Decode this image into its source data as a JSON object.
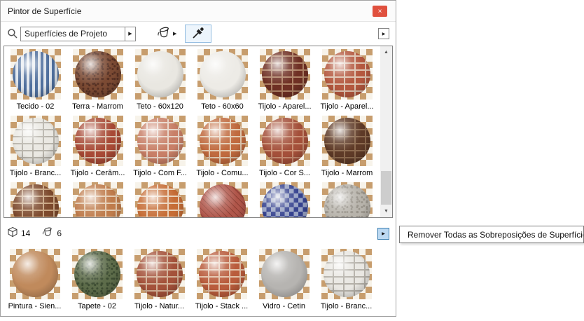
{
  "window": {
    "title": "Pintor de Superfície"
  },
  "icons": {
    "close": "×",
    "flyout": "▶",
    "scroll_up": "▲",
    "scroll_down": "▼"
  },
  "toolbar": {
    "search_value": "Superfícies de Projeto"
  },
  "upper_grid": [
    {
      "label": "Tecido - 02",
      "pattern": "stripes",
      "c1": "#4f6f9d",
      "c2": "#dfe5ec"
    },
    {
      "label": "Terra - Marrom",
      "pattern": "speckle",
      "c1": "#7b4a33",
      "c2": "#553023"
    },
    {
      "label": "Teto - 60x120",
      "pattern": "plain",
      "c1": "#e9e7e1",
      "c2": "#d8d5cd"
    },
    {
      "label": "Teto - 60x60",
      "pattern": "plain",
      "c1": "#edebe6",
      "c2": "#dcd9d2"
    },
    {
      "label": "Tijolo - Aparel...",
      "pattern": "brick",
      "c1": "#6f3024",
      "c2": "#b08468"
    },
    {
      "label": "Tijolo - Aparel...",
      "pattern": "brick",
      "c1": "#b4583f",
      "c2": "#ddc3b0"
    },
    {
      "label": "Tijolo - Branc...",
      "pattern": "brick",
      "c1": "#eae8e2",
      "c2": "#b7b3aa"
    },
    {
      "label": "Tijolo - Cerâm...",
      "pattern": "brick",
      "c1": "#a84a36",
      "c2": "#d9bca9"
    },
    {
      "label": "Tijolo - Com F...",
      "pattern": "brick",
      "c1": "#c87f67",
      "c2": "#e8d5c8"
    },
    {
      "label": "Tijolo - Comu...",
      "pattern": "brick",
      "c1": "#c06a3e",
      "c2": "#e3cbb2"
    },
    {
      "label": "Tijolo - Cor S...",
      "pattern": "brick",
      "c1": "#a4503a",
      "c2": "#c98f74"
    },
    {
      "label": "Tijolo - Marrom",
      "pattern": "brick",
      "c1": "#5e3a27",
      "c2": "#8c6a4f"
    },
    {
      "label": "",
      "pattern": "brick",
      "c1": "#7d4a2d",
      "c2": "#c8a582"
    },
    {
      "label": "",
      "pattern": "brick",
      "c1": "#bf7c4c",
      "c2": "#e4cbb0"
    },
    {
      "label": "",
      "pattern": "brick",
      "c1": "#c66d36",
      "c2": "#ead2ba"
    },
    {
      "label": "",
      "pattern": "herringbone",
      "c1": "#b0564a",
      "c2": "#8c3e33"
    },
    {
      "label": "",
      "pattern": "check",
      "c1": "#35428f",
      "c2": "#9aa4c4"
    },
    {
      "label": "",
      "pattern": "speckle",
      "c1": "#b7b3ab",
      "c2": "#98938a"
    }
  ],
  "status": {
    "materials_count": "14",
    "overrides_count": "6"
  },
  "menu": {
    "remove_all_label": "Remover Todas as Sobreposições de Superfícies"
  },
  "lower_grid": [
    {
      "label": "Pintura - Sien...",
      "pattern": "plain",
      "c1": "#c08a5c",
      "c2": "#a06f48"
    },
    {
      "label": "Tapete - 02",
      "pattern": "speckle",
      "c1": "#5d6c4a",
      "c2": "#3d4c32"
    },
    {
      "label": "Tijolo - Natur...",
      "pattern": "brick",
      "c1": "#a4523a",
      "c2": "#d2b096"
    },
    {
      "label": "Tijolo - Stack ...",
      "pattern": "brick",
      "c1": "#b95c3c",
      "c2": "#e2c1a8"
    },
    {
      "label": "Vidro - Cetin",
      "pattern": "plain",
      "c1": "#b6b4b1",
      "c2": "#99968f"
    },
    {
      "label": "Tijolo - Branc...",
      "pattern": "brick",
      "c1": "#e9e7e2",
      "c2": "#b4b0a8"
    }
  ]
}
